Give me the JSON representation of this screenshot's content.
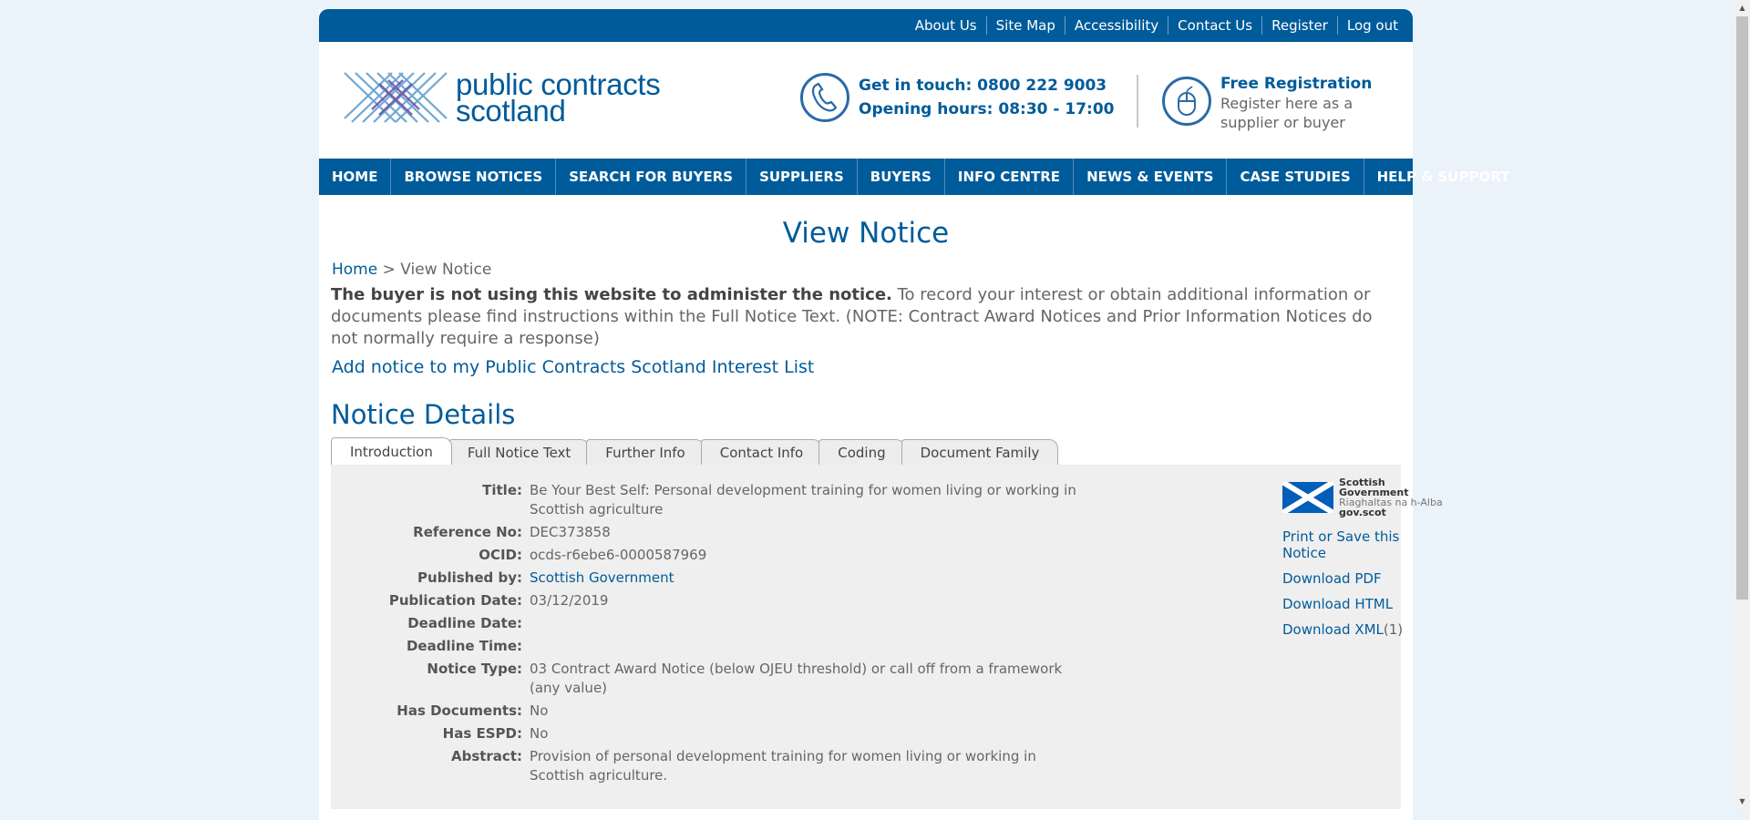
{
  "topbar": {
    "links": [
      "About Us",
      "Site Map",
      "Accessibility",
      "Contact Us",
      "Register",
      "Log out"
    ]
  },
  "header": {
    "logo_line1": "public contracts",
    "logo_line2": "scotland",
    "contact_line1": "Get in touch: 0800 222 9003",
    "contact_line2": "Opening hours: 08:30 - 17:00",
    "reg_title": "Free Registration",
    "reg_sub1": "Register here as a",
    "reg_sub2": "supplier or buyer"
  },
  "nav": {
    "items": [
      "HOME",
      "BROWSE NOTICES",
      "SEARCH FOR BUYERS",
      "SUPPLIERS",
      "BUYERS",
      "INFO CENTRE",
      "NEWS & EVENTS",
      "CASE STUDIES",
      "HELP & SUPPORT"
    ]
  },
  "page": {
    "title": "View Notice",
    "breadcrumb_home": "Home",
    "breadcrumb_sep": " > ",
    "breadcrumb_current": "View Notice",
    "notice_bold": "The buyer is not using this website to administer the notice.",
    "notice_rest": " To record your interest or obtain additional information or documents please find instructions within the Full Notice Text. (NOTE: Contract Award Notices and Prior Information Notices do not normally require a response)",
    "interest_link": "Add notice to my Public Contracts Scotland Interest List",
    "section_title": "Notice Details"
  },
  "tabs": [
    "Introduction",
    "Full Notice Text",
    "Further Info",
    "Contact Info",
    "Coding",
    "Document Family"
  ],
  "details": [
    {
      "label": "Title:",
      "value": "Be Your Best Self: Personal development training for women living or working in Scottish agriculture"
    },
    {
      "label": "Reference No:",
      "value": "DEC373858"
    },
    {
      "label": "OCID:",
      "value": "ocds-r6ebe6-0000587969"
    },
    {
      "label": "Published by:",
      "value": "Scottish Government"
    },
    {
      "label": "Publication Date:",
      "value": "03/12/2019"
    },
    {
      "label": "Deadline Date:",
      "value": ""
    },
    {
      "label": "Deadline Time:",
      "value": ""
    },
    {
      "label": "Notice Type:",
      "value": "03 Contract Award Notice (below OJEU threshold) or call off from a framework (any value)"
    },
    {
      "label": "Has Documents:",
      "value": "No"
    },
    {
      "label": "Has ESPD:",
      "value": "No"
    },
    {
      "label": "Abstract:",
      "value": "Provision of personal development training for women living or working in Scottish agriculture."
    }
  ],
  "side": {
    "sg_line1": "Scottish Government",
    "sg_line2": "Riaghaltas na h-Alba",
    "sg_line3": "gov.scot",
    "print": "Print or Save this Notice",
    "pdf": "Download PDF",
    "html": "Download HTML",
    "xml": "Download XML",
    "xml_count": "(1)"
  },
  "colors": {
    "brand_blue": "#005b9a",
    "background": "#eaf2fa",
    "panel": "#efefef"
  }
}
